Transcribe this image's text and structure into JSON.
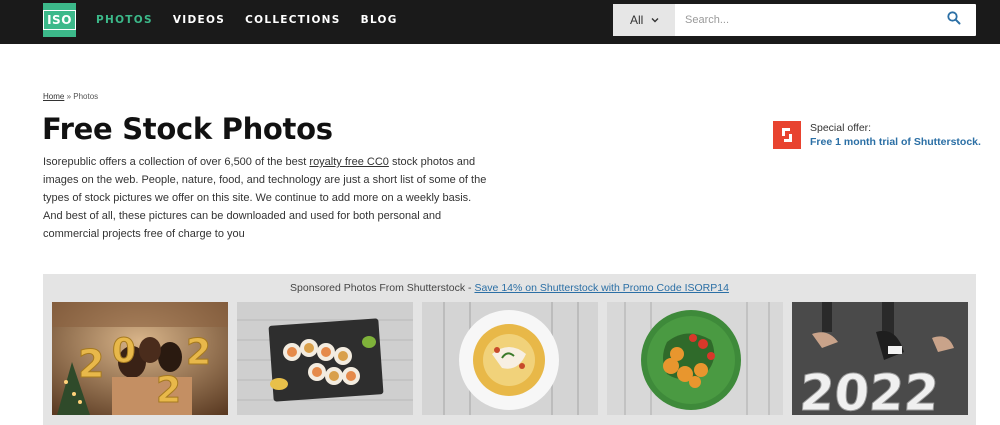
{
  "header": {
    "logo_text": "ISO",
    "nav": [
      {
        "label": "PHOTOS",
        "active": true
      },
      {
        "label": "VIDEOS",
        "active": false
      },
      {
        "label": "COLLECTIONS",
        "active": false
      },
      {
        "label": "BLOG",
        "active": false
      }
    ],
    "search": {
      "scope_value": "All",
      "placeholder": "Search..."
    }
  },
  "breadcrumb": {
    "home": "Home",
    "separator": " » ",
    "current": "Photos"
  },
  "page_title": "Free Stock Photos",
  "intro": {
    "before_link": "Isorepublic offers a collection of over 6,500 of the best ",
    "link": "royalty free CC0",
    "after_link": " stock photos and images on the web. People, nature, food, and technology are just a short list of some of the types of stock pictures we offer on this site. We continue to add more on a weekly basis. And best of all, these pictures can be downloaded and used for both personal and commercial projects free of charge to you"
  },
  "offer": {
    "label": "Special offer:",
    "link": "Free 1 month trial of Shutterstock."
  },
  "sponsored": {
    "heading": "Sponsored Photos From Shutterstock - ",
    "promo_link": "Save 14% on Shutterstock with Promo Code ISORP14",
    "thumbnails": [
      {
        "subject": "new-year-party-2022-balloons"
      },
      {
        "subject": "sushi-rolls-on-slate"
      },
      {
        "subject": "soup-bowl-on-wood"
      },
      {
        "subject": "chicken-salad-plate"
      },
      {
        "subject": "feet-on-2022-road"
      }
    ],
    "thumb_text": "2022"
  },
  "colors": {
    "accent": "#3cb98a",
    "header_bg": "#1a1a1a",
    "link_blue": "#2b6fa5",
    "shutterstock_red": "#e8432f"
  }
}
